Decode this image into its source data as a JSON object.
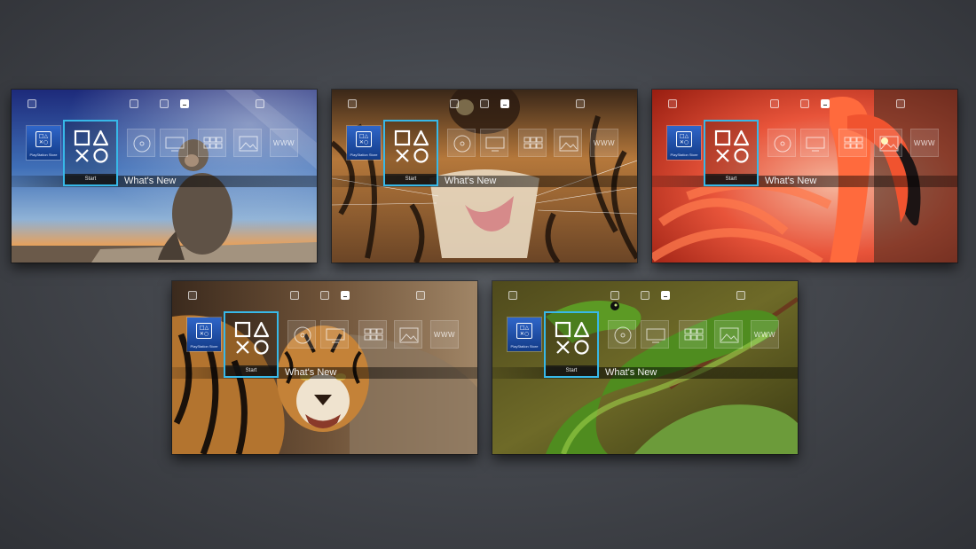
{
  "colors": {
    "background": "#45484e",
    "focus_border": "#37b8e8",
    "store_blue": "#1e4ea8"
  },
  "screenshots": [
    {
      "theme": "monkey",
      "store_label": "PlayStation Store",
      "tile_label": "Start",
      "section_title": "What's New",
      "www_label": "WWW",
      "icons": [
        "notification-icon",
        "friends-icon",
        "messages-icon",
        "profile-icon",
        "settings-icon"
      ]
    },
    {
      "theme": "tiger-closeup",
      "store_label": "PlayStation Store",
      "tile_label": "Start",
      "section_title": "What's New",
      "www_label": "WWW",
      "icons": [
        "notification-icon",
        "friends-icon",
        "messages-icon",
        "profile-icon",
        "settings-icon"
      ]
    },
    {
      "theme": "flamingo",
      "store_label": "PlayStation Store",
      "tile_label": "Start",
      "section_title": "What's New",
      "www_label": "WWW",
      "icons": [
        "notification-icon",
        "friends-icon",
        "messages-icon",
        "profile-icon",
        "settings-icon"
      ]
    },
    {
      "theme": "tiger",
      "store_label": "PlayStation Store",
      "tile_label": "Start",
      "section_title": "What's New",
      "www_label": "WWW",
      "icons": [
        "notification-icon",
        "friends-icon",
        "messages-icon",
        "profile-icon",
        "settings-icon"
      ]
    },
    {
      "theme": "snake",
      "store_label": "PlayStation Store",
      "tile_label": "Start",
      "section_title": "What's New",
      "www_label": "WWW",
      "icons": [
        "notification-icon",
        "friends-icon",
        "messages-icon",
        "profile-icon",
        "settings-icon"
      ]
    }
  ]
}
